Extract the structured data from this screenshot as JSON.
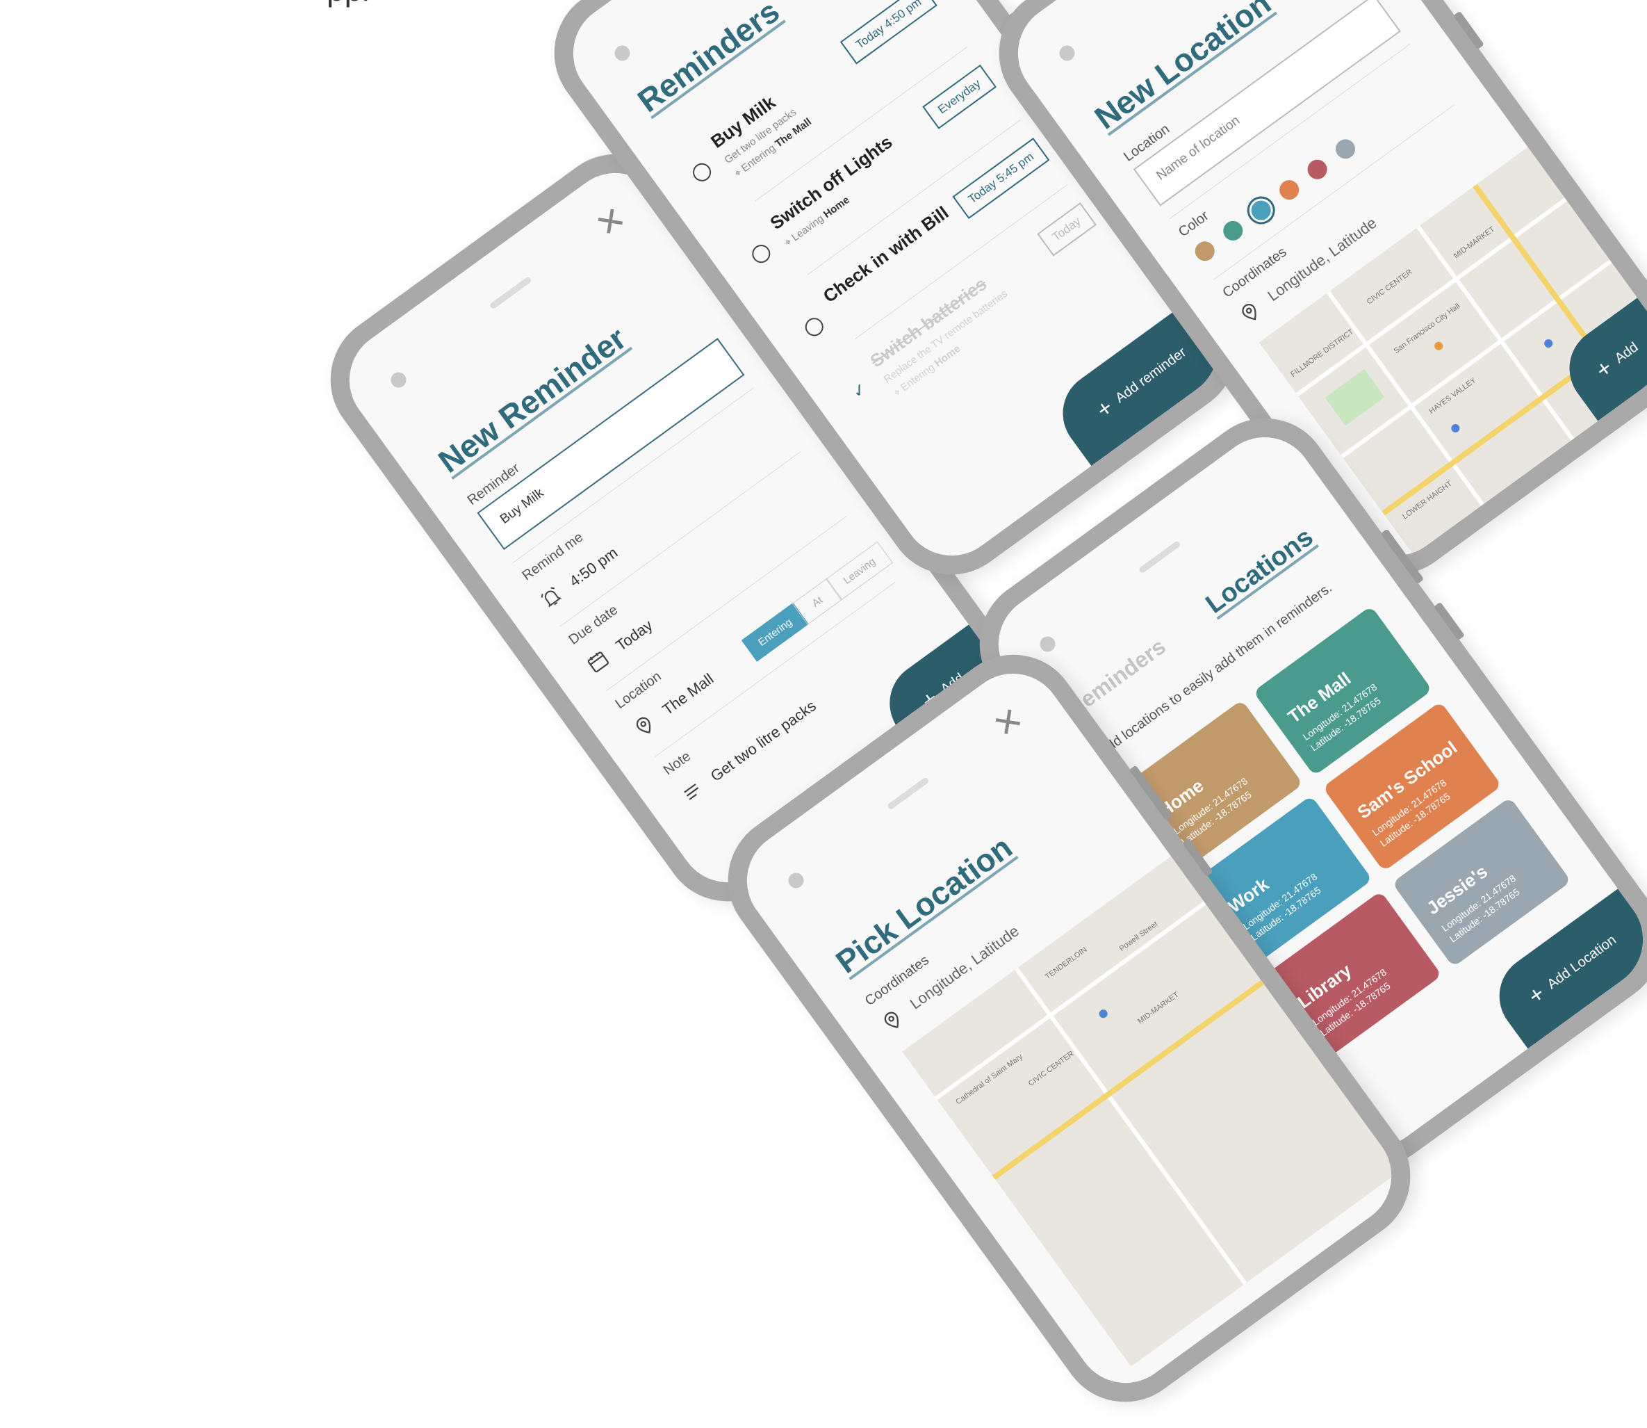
{
  "header_fragment": "ppl",
  "new_reminder": {
    "title": "New Reminder",
    "reminder_label": "Reminder",
    "reminder_value": "Buy Milk",
    "remind_me_label": "Remind me",
    "remind_me_value": "4:50 pm",
    "due_date_label": "Due date",
    "due_date_value": "Today",
    "location_label": "Location",
    "location_value": "The Mall",
    "location_modes": [
      "Entering",
      "At",
      "Leaving"
    ],
    "note_label": "Note",
    "note_value": "Get two litre packs",
    "add_label": "Add"
  },
  "reminders": {
    "title": "Reminders",
    "items": [
      {
        "title": "Buy Milk",
        "subtitle": "Get two litre packs",
        "trigger": "Entering",
        "place": "The Mall",
        "chip": "Today 4:50 pm",
        "done": false
      },
      {
        "title": "Switch off Lights",
        "subtitle": "",
        "trigger": "Leaving",
        "place": "Home",
        "chip": "Everyday",
        "done": false
      },
      {
        "title": "Check in with Bill",
        "subtitle": "",
        "trigger": "",
        "place": "",
        "chip": "Today 5:45 pm",
        "done": false
      },
      {
        "title": "Switch batteries",
        "subtitle": "Replace the TV remote batteries",
        "trigger": "Entering",
        "place": "Home",
        "chip": "Today",
        "done": true
      }
    ],
    "add_label": "Add reminder"
  },
  "new_location": {
    "title": "New Location",
    "location_label": "Location",
    "location_placeholder": "Name of location",
    "color_label": "Color",
    "colors": [
      "#c19a6b",
      "#4a9b8e",
      "#4a9fbd",
      "#e0824f",
      "#b85a63",
      "#9aa7b0"
    ],
    "selected_color_index": 2,
    "coordinates_label": "Coordinates",
    "coordinates_value": "Longitude, Latitude",
    "map_labels": [
      "CIVIC CENTER",
      "MID-MARKET",
      "HAYES VALLEY",
      "LOWER HAIGHT",
      "FILLMORE DISTRICT",
      "San Francisco City Hall"
    ],
    "add_label": "Add"
  },
  "locations": {
    "tab_reminders": "Reminders",
    "tab_locations": "Locations",
    "hint": "Add locations to easily add them in reminders.",
    "cards": [
      {
        "name": "The Mall",
        "longitude": "Longitude: 21.47678",
        "latitude": "Latitude: -18.78765",
        "color": "#4a9b8e"
      },
      {
        "name": "Home",
        "longitude": "Longitude: 21.47678",
        "latitude": "Latitude: -18.78765",
        "color": "#c19a6b"
      },
      {
        "name": "Sam's School",
        "longitude": "Longitude: 21.47678",
        "latitude": "Latitude: -18.78765",
        "color": "#e0824f"
      },
      {
        "name": "Work",
        "longitude": "Longitude: 21.47678",
        "latitude": "Latitude: -18.78765",
        "color": "#4a9fbd"
      },
      {
        "name": "Jessie's",
        "longitude": "Longitude: 21.47678",
        "latitude": "Latitude: -18.78765",
        "color": "#9aa7b0"
      },
      {
        "name": "Library",
        "longitude": "Longitude: 21.47678",
        "latitude": "Latitude: -18.78765",
        "color": "#b85a63"
      }
    ],
    "add_label": "Add Location"
  },
  "pick_location": {
    "title": "Pick Location",
    "coordinates_label": "Coordinates",
    "coordinates_value": "Longitude, Latitude",
    "map_labels": [
      "TENDERLOIN",
      "CIVIC CENTER",
      "MID-MARKET",
      "Powell Street",
      "Cathedral of Saint Mary"
    ]
  },
  "colors": {
    "accent": "#2f6a7d",
    "fab": "#2c5d6a",
    "frame": "#a9a9a9",
    "screen": "#f8f8f8"
  }
}
